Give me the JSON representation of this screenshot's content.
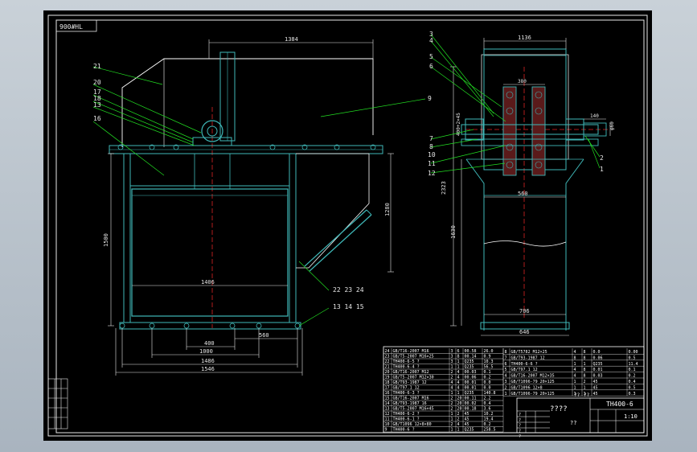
{
  "colors": {
    "frame": "#e8e8e8",
    "steel": "#3fb8b8",
    "dim": "#e6e6e6",
    "leader": "#22dd22",
    "center": "#dd2222",
    "body": "#ffffff",
    "table": "#ffffff"
  },
  "stamp": "900#HL",
  "front_view": {
    "dims": {
      "top_width": "1384",
      "height_right": "1280",
      "height_left": "1500",
      "inner_width": "1406",
      "d400": "400",
      "d560": "560",
      "d1000": "1000",
      "d1486": "1486",
      "d1546": "1546"
    },
    "balloons": [
      "21",
      "20",
      "17",
      "18",
      "13",
      "16",
      "9",
      "22 23 24",
      "13 14 15"
    ]
  },
  "side_view": {
    "dims": {
      "top_width": "1136",
      "gear_width": "380",
      "left_vertical": "400+2×45",
      "shaft_len": "140",
      "shaft_dia": "φ60",
      "total_height": "2323",
      "lower_height": "1630",
      "inner_width": "560",
      "bottom_inner": "706",
      "bottom_outer": "646"
    },
    "balloons": [
      "3",
      "4",
      "5",
      "6",
      "7",
      "8",
      "10",
      "11",
      "12",
      "2",
      "1"
    ]
  },
  "title_block": {
    "drawing_no": "TH400-6",
    "title": "????",
    "scale": "1:10",
    "name_short": "??",
    "sheet_mark": "??",
    "qty_mark": "??",
    "left_rows": [
      [
        "24",
        "GB/T16-2007 M16",
        "3",
        "6",
        "00.58",
        "26.0"
      ],
      [
        "23",
        "GB/T5-2007 M16×25",
        "3",
        "8",
        "00.14",
        "0.9"
      ],
      [
        "22",
        "TH400-6-5 ?",
        "3",
        "1",
        "Q235",
        "10.3"
      ],
      [
        "21",
        "TH400-6-4 ?",
        "1",
        "1",
        "Q235",
        "56.5"
      ],
      [
        "20",
        "GB/T16-2007 M12",
        "2",
        "4",
        "00.03",
        "0.1"
      ],
      [
        "19",
        "GB/T5-2007 M12×30",
        "2",
        "4",
        "00.06",
        "0.2"
      ],
      [
        "18",
        "GB/T93-1987 12",
        "4",
        "4",
        "00.01",
        "0.0"
      ],
      [
        "17",
        "GB/T97.1 12",
        "4",
        "4",
        "00.01",
        "0.0"
      ],
      [
        "16",
        "TH400-6-3 ?",
        "1",
        "1",
        "Q235",
        "140.8"
      ],
      [
        "15",
        "GB/T16-2007 M16",
        "2",
        "20",
        "00.11",
        "2.2"
      ],
      [
        "14",
        "GB/T93-1987 16",
        "2",
        "20",
        "00.02",
        "0.4"
      ],
      [
        "13",
        "GB/T5-2007 M16×45",
        "2",
        "20",
        "00.18",
        "3.6"
      ],
      [
        "12",
        "TH400-6-2 ?",
        "1",
        "2",
        "45",
        "10.2"
      ],
      [
        "11",
        "TH400-6-1 ?",
        "1",
        "2",
        "45",
        "19.4"
      ],
      [
        "10",
        "GB/T1096 12×8×80",
        "2",
        "4",
        "45",
        "0.2"
      ],
      [
        "9",
        "TH400-6 ?",
        "1",
        "1",
        "Q235",
        "258.5"
      ]
    ],
    "right_rows": [
      [
        "8",
        "GB/T5782 M12×25",
        "4",
        "8",
        "0.0",
        "0.00"
      ],
      [
        "7",
        "GB/T93-1987 12",
        "8",
        "8",
        "0.06",
        "0.5"
      ],
      [
        "6",
        "TH400-6-6 ?",
        "1",
        "1",
        "Q235",
        "11.4"
      ],
      [
        "5",
        "GB/T97.1 12",
        "4",
        "8",
        "0.01",
        "0.1"
      ],
      [
        "4",
        "GB/T16-2007 M12×35",
        "4",
        "8",
        "0.03",
        "0.2"
      ],
      [
        "3",
        "GB/T1096-79 20×125",
        "1",
        "2",
        "45",
        "0.4"
      ],
      [
        "2",
        "GB/T1096 12×8",
        "1",
        "1",
        "45",
        "0.5"
      ],
      [
        "1",
        "GB/T1096-79 20×125",
        "1",
        "1",
        "45",
        "0.3"
      ]
    ],
    "sig_rows": [
      "?",
      "?",
      "?",
      "?",
      "?"
    ]
  }
}
